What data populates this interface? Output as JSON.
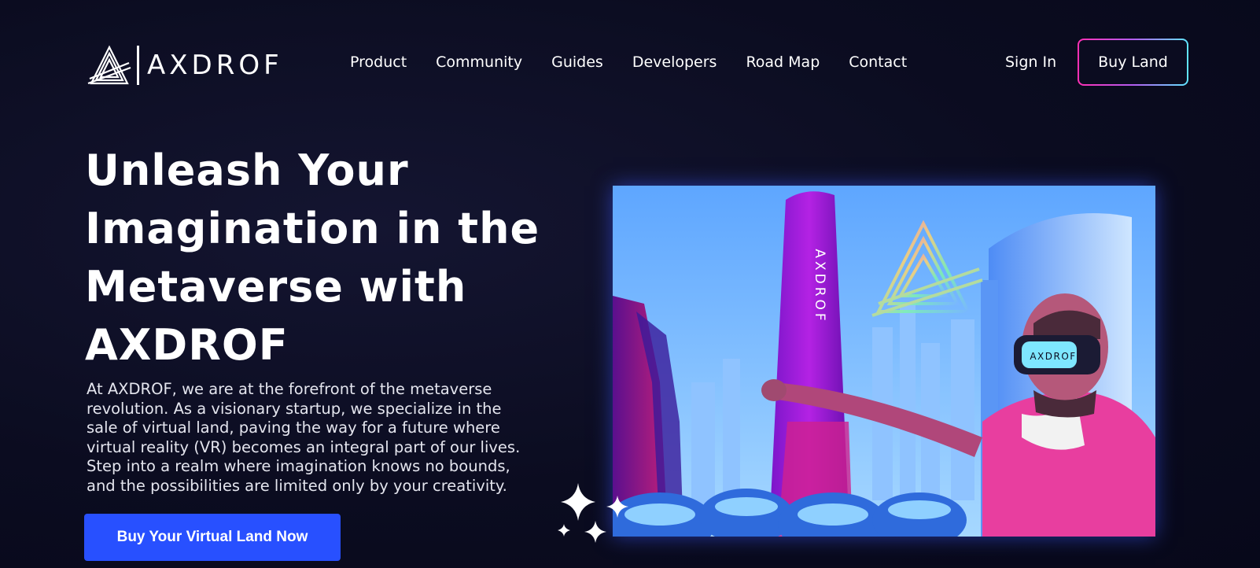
{
  "brand": {
    "name": "AXDROF",
    "icon": "axdrof-triangle-logo"
  },
  "nav": {
    "links": [
      {
        "label": "Product"
      },
      {
        "label": "Community"
      },
      {
        "label": "Guides"
      },
      {
        "label": "Developers"
      },
      {
        "label": "Road Map"
      },
      {
        "label": "Contact"
      }
    ],
    "signin_label": "Sign In",
    "buy_land_label": "Buy Land"
  },
  "hero": {
    "title_lines": [
      "Unleash Your",
      "Imagination in the",
      "Metaverse with",
      "AXDROF"
    ],
    "description_lines": [
      "At AXDROF, we are at the forefront of the metaverse",
      "revolution. As a visionary startup, we specialize in the",
      "sale of virtual land, paving the way for a future where",
      "virtual reality (VR) becomes an integral part of our lives.",
      "Step into a realm where imagination knows no bounds,",
      "and the possibilities are limited only by your creativity."
    ],
    "cta_label": "Buy Your Virtual Land  Now",
    "image": {
      "icon": "vr-metaverse-city-illustration",
      "tower_text": "AXDROF",
      "headset_text": "AXDROF"
    },
    "sparkles_icon": "sparkles-icon"
  },
  "colors": {
    "background": "#0b0c20",
    "cta": "#2850ff",
    "border_gradient_start": "#ff2fb4",
    "border_gradient_end": "#5fe6ff"
  }
}
